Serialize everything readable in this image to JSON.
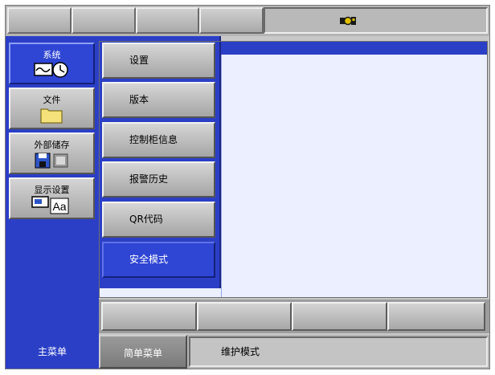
{
  "status_bar": {
    "icon": "robot-status-icon"
  },
  "main_menu": {
    "items": [
      {
        "label": "系统",
        "icon": "system-monitor-clock-icon",
        "active": true
      },
      {
        "label": "文件",
        "icon": "folder-icon",
        "active": false
      },
      {
        "label": "外部储存",
        "icon": "external-storage-icon",
        "active": false
      },
      {
        "label": "显示设置",
        "icon": "display-settings-icon",
        "active": false
      }
    ]
  },
  "submenu": {
    "items": [
      {
        "label": "设置"
      },
      {
        "label": "版本"
      },
      {
        "label": "控制柜信息"
      },
      {
        "label": "报警历史"
      },
      {
        "label": "QR代码"
      },
      {
        "label": "安全模式",
        "highlighted": true
      }
    ]
  },
  "bottom_bar": {
    "main_menu_label": "主菜单",
    "simple_menu_label": "简单菜单",
    "mode_text": "维护模式"
  },
  "colors": {
    "accent_blue": "#2b3fc6",
    "content_background": "#ebefff",
    "button_gray": "#b4b4b4"
  }
}
